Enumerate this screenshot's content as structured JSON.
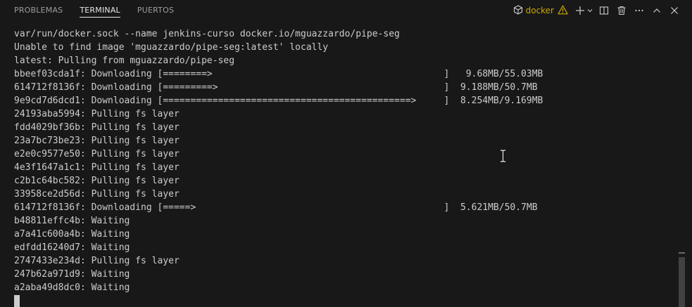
{
  "panel": {
    "tabs": [
      {
        "label": "PROBLEMAS",
        "active": false
      },
      {
        "label": "TERMINAL",
        "active": true
      },
      {
        "label": "PUERTOS",
        "active": false
      }
    ],
    "terminal_instance": {
      "label": "docker",
      "icon": "container-icon",
      "warning_icon": "warning-icon",
      "accent_color": "#cca700"
    },
    "actions": [
      "add-terminal-icon",
      "chevron-down-icon",
      "split-terminal-icon",
      "trash-icon",
      "more-icon",
      "maximize-panel-icon",
      "close-icon"
    ]
  },
  "terminal": {
    "lines": [
      "var/run/docker.sock --name jenkins-curso docker.io/mguazzardo/pipe-seg",
      "Unable to find image 'mguazzardo/pipe-seg:latest' locally",
      "latest: Pulling from mguazzardo/pipe-seg",
      "bbeef03cda1f: Downloading [========>                                          ]   9.68MB/55.03MB",
      "614712f8136f: Downloading [=========>                                         ]  9.188MB/50.7MB",
      "9e9cd7d6dcd1: Downloading [=============================================>     ]  8.254MB/9.169MB",
      "24193aba5994: Pulling fs layer",
      "fdd4029bf36b: Pulling fs layer",
      "23a7bc73be23: Pulling fs layer",
      "e2e0c9577e50: Pulling fs layer",
      "4e3f1647a1c1: Pulling fs layer",
      "c2b1c64bc582: Pulling fs layer",
      "33958ce2d56d: Pulling fs layer",
      "614712f8136f: Downloading [=====>                                             ]  5.621MB/50.7MB",
      "b48811effc4b: Waiting",
      "a7a41c600a4b: Waiting",
      "edfdd16240d7: Waiting",
      "2747433e234d: Pulling fs layer",
      "247b62a971d9: Waiting",
      "a2aba49d8dc0: Waiting"
    ]
  },
  "colors": {
    "background": "#181818",
    "text": "#cccccc",
    "inactive_tab": "#9d9d9d",
    "active_tab": "#e7e7e7"
  }
}
